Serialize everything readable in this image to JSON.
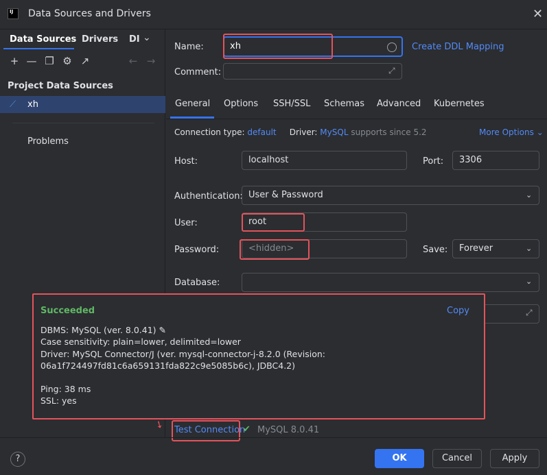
{
  "window": {
    "title": "Data Sources and Drivers",
    "app_icon": "IJ",
    "close_icon": "close-icon"
  },
  "left": {
    "tabs": [
      "Data Sources",
      "Drivers",
      "DI"
    ],
    "section_title": "Project Data Sources",
    "data_source": "xh",
    "problems": "Problems"
  },
  "form": {
    "name_label": "Name:",
    "name_value": "xh",
    "create_ddl": "Create DDL Mapping",
    "comment_label": "Comment:",
    "tabs": [
      "General",
      "Options",
      "SSH/SSL",
      "Schemas",
      "Advanced",
      "Kubernetes"
    ],
    "connection_type_label": "Connection type:",
    "connection_type_value": "default",
    "driver_label": "Driver:",
    "driver_value": "MySQL",
    "driver_note": "supports since 5.2",
    "more_options": "More Options",
    "host_label": "Host:",
    "host_value": "localhost",
    "port_label": "Port:",
    "port_value": "3306",
    "auth_label": "Authentication:",
    "auth_value": "User & Password",
    "user_label": "User:",
    "user_value": "root",
    "password_label": "Password:",
    "password_placeholder": "<hidden>",
    "save_label": "Save:",
    "save_value": "Forever",
    "database_label": "Database:",
    "database_value": ""
  },
  "popup": {
    "title": "Succeeded",
    "copy": "Copy",
    "lines": [
      "DBMS: MySQL (ver. 8.0.41)",
      "Case sensitivity: plain=lower, delimited=lower",
      "Driver: MySQL Connector/J (ver. mysql-connector-j-8.2.0 (Revision:",
      "06a1f724497fd81c6a659131fda822c9e5085b6c), JDBC4.2)",
      "Ping: 38 ms",
      "SSL: yes"
    ]
  },
  "test": {
    "link": "Test Connection",
    "check": "✔",
    "result": "MySQL 8.0.41"
  },
  "buttons": {
    "help": "?",
    "ok": "OK",
    "cancel": "Cancel",
    "apply": "Apply"
  }
}
